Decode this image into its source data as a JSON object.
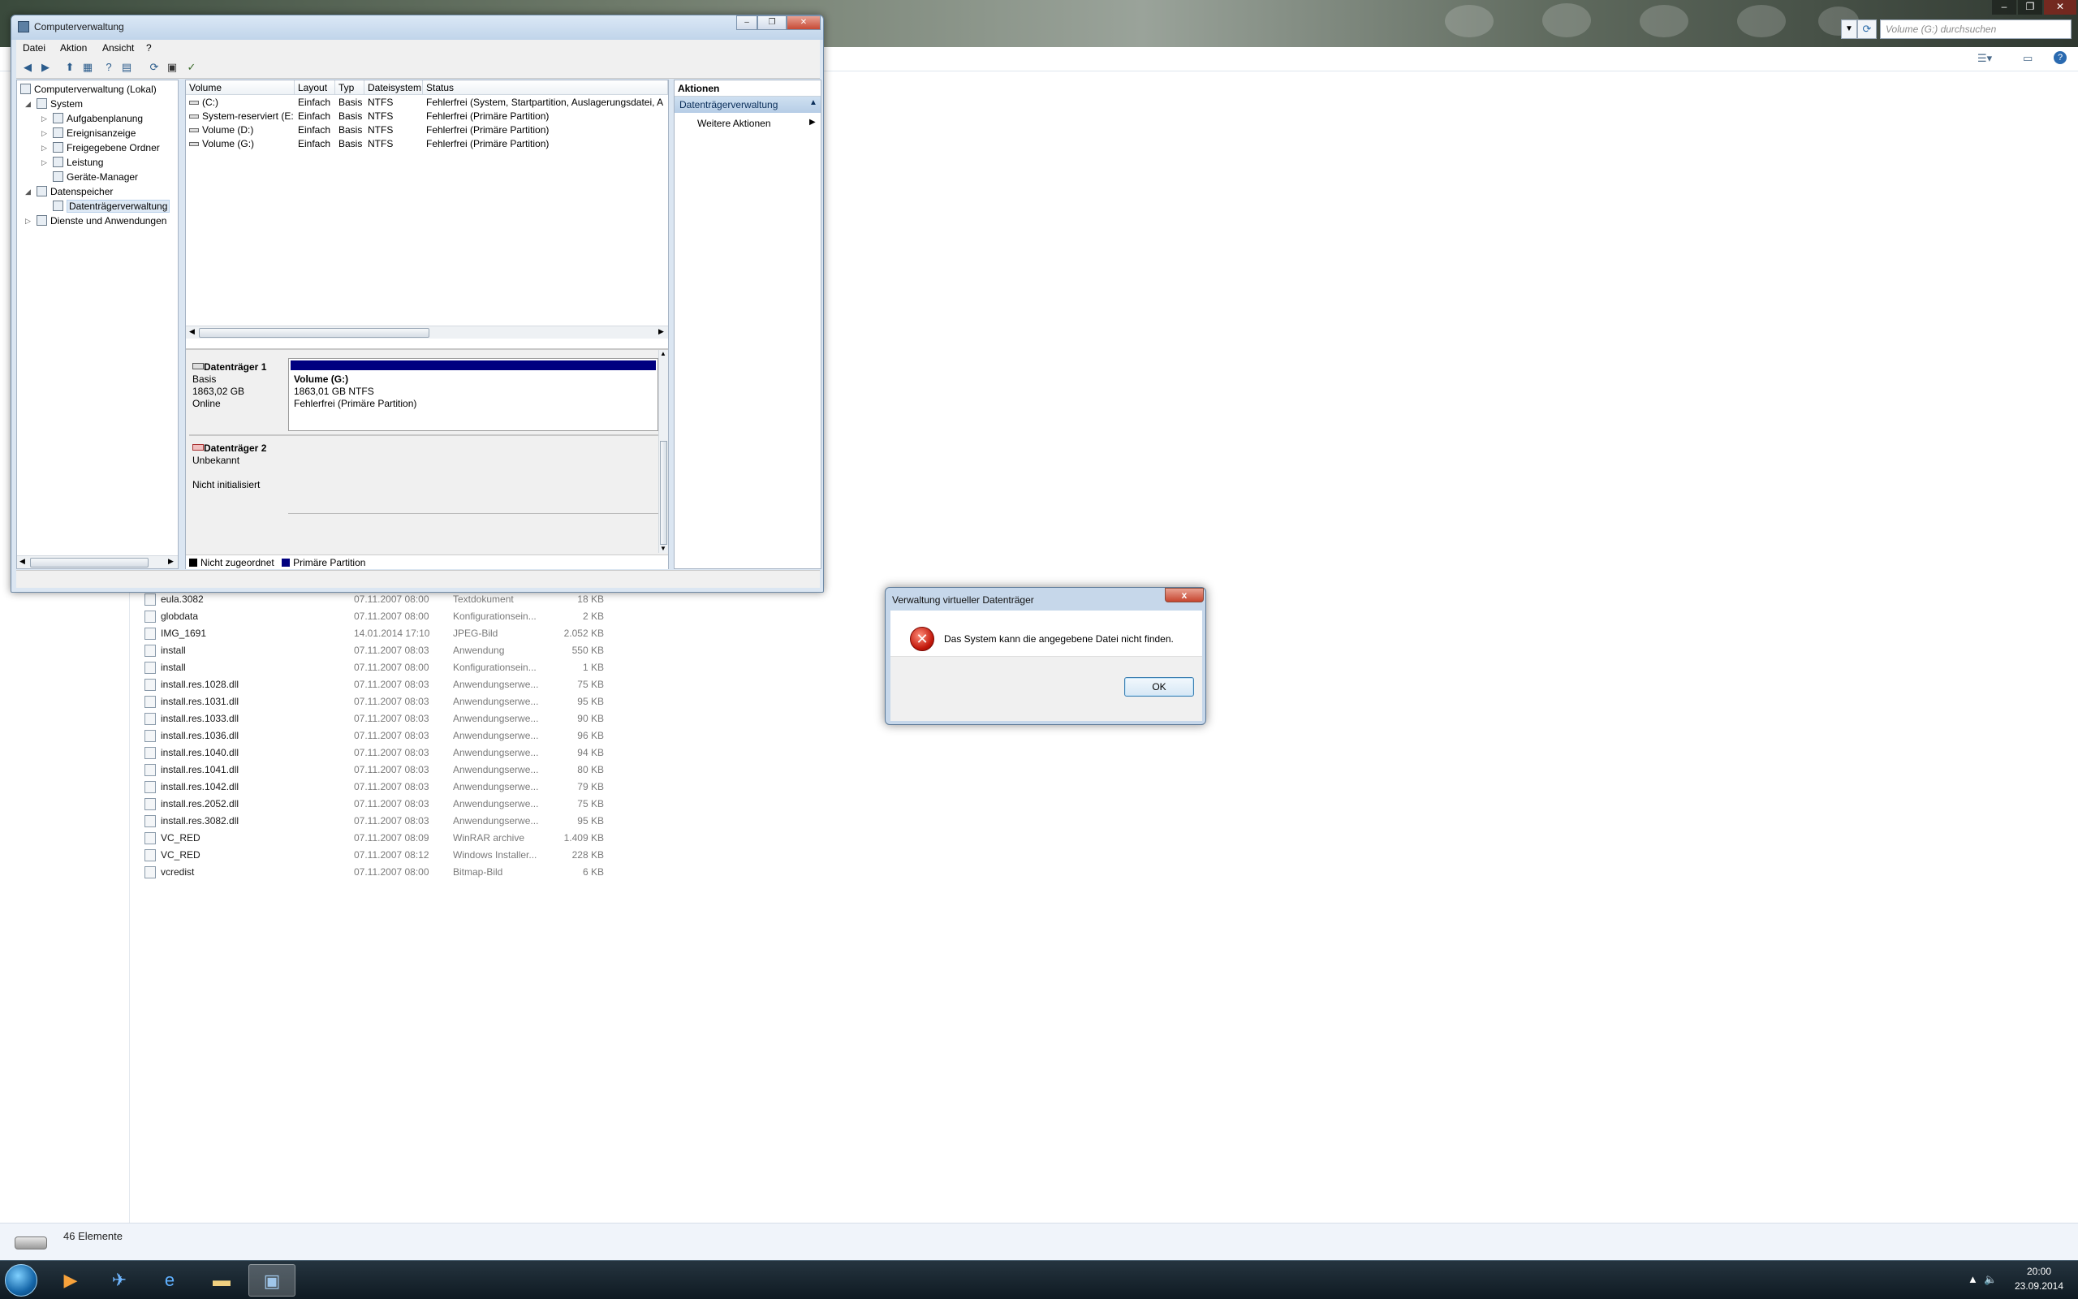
{
  "explorer": {
    "search_placeholder": "Volume (G:) durchsuchen",
    "status_count": "46 Elemente",
    "files": [
      {
        "name": "eula.3082",
        "date": "07.11.2007 08:00",
        "type": "Textdokument",
        "size": "18 KB"
      },
      {
        "name": "globdata",
        "date": "07.11.2007 08:00",
        "type": "Konfigurationsein...",
        "size": "2 KB"
      },
      {
        "name": "IMG_1691",
        "date": "14.01.2014 17:10",
        "type": "JPEG-Bild",
        "size": "2.052 KB"
      },
      {
        "name": "install",
        "date": "07.11.2007 08:03",
        "type": "Anwendung",
        "size": "550 KB"
      },
      {
        "name": "install",
        "date": "07.11.2007 08:00",
        "type": "Konfigurationsein...",
        "size": "1 KB"
      },
      {
        "name": "install.res.1028.dll",
        "date": "07.11.2007 08:03",
        "type": "Anwendungserwe...",
        "size": "75 KB"
      },
      {
        "name": "install.res.1031.dll",
        "date": "07.11.2007 08:03",
        "type": "Anwendungserwe...",
        "size": "95 KB"
      },
      {
        "name": "install.res.1033.dll",
        "date": "07.11.2007 08:03",
        "type": "Anwendungserwe...",
        "size": "90 KB"
      },
      {
        "name": "install.res.1036.dll",
        "date": "07.11.2007 08:03",
        "type": "Anwendungserwe...",
        "size": "96 KB"
      },
      {
        "name": "install.res.1040.dll",
        "date": "07.11.2007 08:03",
        "type": "Anwendungserwe...",
        "size": "94 KB"
      },
      {
        "name": "install.res.1041.dll",
        "date": "07.11.2007 08:03",
        "type": "Anwendungserwe...",
        "size": "80 KB"
      },
      {
        "name": "install.res.1042.dll",
        "date": "07.11.2007 08:03",
        "type": "Anwendungserwe...",
        "size": "79 KB"
      },
      {
        "name": "install.res.2052.dll",
        "date": "07.11.2007 08:03",
        "type": "Anwendungserwe...",
        "size": "75 KB"
      },
      {
        "name": "install.res.3082.dll",
        "date": "07.11.2007 08:03",
        "type": "Anwendungserwe...",
        "size": "95 KB"
      },
      {
        "name": "VC_RED",
        "date": "07.11.2007 08:09",
        "type": "WinRAR archive",
        "size": "1.409 KB"
      },
      {
        "name": "VC_RED",
        "date": "07.11.2007 08:12",
        "type": "Windows Installer...",
        "size": "228 KB"
      },
      {
        "name": "vcredist",
        "date": "07.11.2007 08:00",
        "type": "Bitmap-Bild",
        "size": "6 KB"
      }
    ]
  },
  "compmgmt": {
    "title": "Computerverwaltung",
    "menu": [
      "Datei",
      "Aktion",
      "Ansicht",
      "?"
    ],
    "tree": {
      "root": "Computerverwaltung (Lokal)",
      "system": "System",
      "aufgaben": "Aufgabenplanung",
      "ereignis": "Ereignisanzeige",
      "freigegeben": "Freigegebene Ordner",
      "leistung": "Leistung",
      "geraete": "Geräte-Manager",
      "datenspeicher": "Datenspeicher",
      "datentraeger": "Datenträgerverwaltung",
      "dienste": "Dienste und Anwendungen"
    },
    "columns": [
      "Volume",
      "Layout",
      "Typ",
      "Dateisystem",
      "Status"
    ],
    "volumes": [
      {
        "volume": "(C:)",
        "layout": "Einfach",
        "typ": "Basis",
        "fs": "NTFS",
        "status": "Fehlerfrei (System, Startpartition, Auslagerungsdatei, A"
      },
      {
        "volume": "System-reserviert (E:)",
        "layout": "Einfach",
        "typ": "Basis",
        "fs": "NTFS",
        "status": "Fehlerfrei (Primäre Partition)"
      },
      {
        "volume": "Volume (D:)",
        "layout": "Einfach",
        "typ": "Basis",
        "fs": "NTFS",
        "status": "Fehlerfrei (Primäre Partition)"
      },
      {
        "volume": "Volume (G:)",
        "layout": "Einfach",
        "typ": "Basis",
        "fs": "NTFS",
        "status": "Fehlerfrei (Primäre Partition)"
      }
    ],
    "disk1": {
      "name": "Datenträger 1",
      "type": "Basis",
      "size": "1863,02 GB",
      "state": "Online",
      "part_name": "Volume  (G:)",
      "part_size": "1863,01 GB NTFS",
      "part_status": "Fehlerfrei (Primäre Partition)"
    },
    "disk2": {
      "name": "Datenträger 2",
      "type": "Unbekannt",
      "state": "Nicht initialisiert"
    },
    "legend": {
      "unalloc": "Nicht zugeordnet",
      "primary": "Primäre Partition"
    },
    "actions": {
      "header": "Aktionen",
      "section": "Datenträgerverwaltung",
      "more": "Weitere Aktionen"
    }
  },
  "dialog": {
    "title": "Verwaltung virtueller Datenträger",
    "message": "Das System kann die angegebene Datei nicht finden.",
    "ok": "OK",
    "close": "x"
  },
  "taskbar": {
    "time": "20:00",
    "date": "23.09.2014"
  },
  "colors": {
    "primary_partition": "#000080",
    "unallocated": "#000000",
    "error": "#c1170b"
  }
}
